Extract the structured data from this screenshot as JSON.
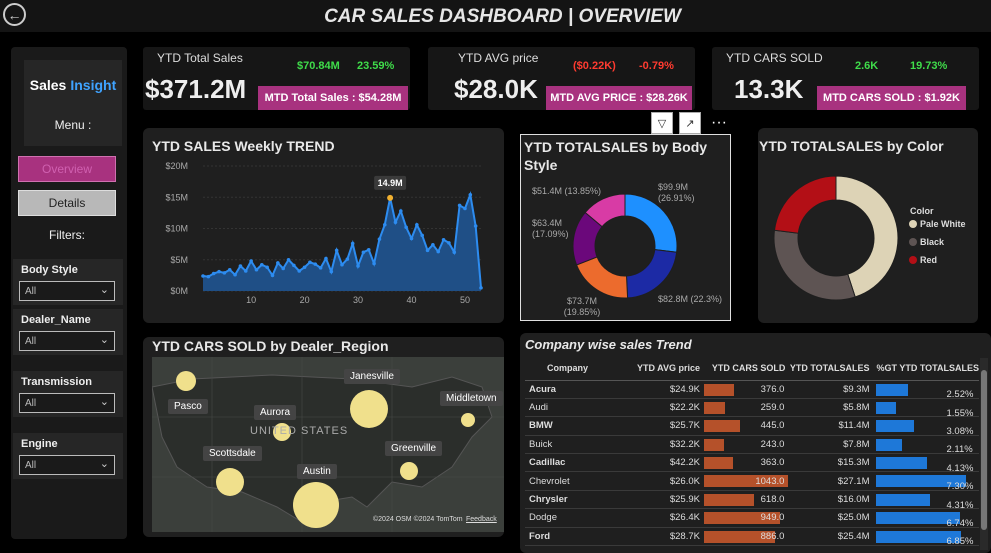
{
  "header": {
    "title": "CAR SALES DASHBOARD | OVERVIEW",
    "back_icon": "back-arrow-icon"
  },
  "sidebar": {
    "brand_part1": "Sales",
    "brand_part2": "Insight",
    "menu_label": "Menu :",
    "nav": [
      {
        "label": "Overview",
        "active": true
      },
      {
        "label": "Details",
        "active": false
      }
    ],
    "filters_label": "Filters:",
    "filters": [
      {
        "label": "Body Style",
        "value": "All"
      },
      {
        "label": "Dealer_Name",
        "value": "All"
      },
      {
        "label": "Transmission",
        "value": "All"
      },
      {
        "label": "Engine",
        "value": "All"
      }
    ]
  },
  "kpis": [
    {
      "label": "YTD Total Sales",
      "value": "$371.2M",
      "delta": "$70.84M",
      "pct": "23.59%",
      "trend": "up",
      "mtd": "MTD Total Sales : $54.28M"
    },
    {
      "label": "YTD AVG price",
      "value": "$28.0K",
      "delta": "($0.22K)",
      "pct": "-0.79%",
      "trend": "down",
      "mtd": "MTD AVG PRICE : $28.26K"
    },
    {
      "label": "YTD CARS SOLD",
      "value": "13.3K",
      "delta": "2.6K",
      "pct": "19.73%",
      "trend": "up",
      "mtd": "MTD CARS SOLD : $1.92K"
    }
  ],
  "visual_tools": {
    "filter_icon": "filter-icon",
    "focus_icon": "focus-mode-icon",
    "more_icon": "more-options-icon",
    "more_label": "···"
  },
  "weekly_trend": {
    "title": "YTD SALES Weekly TREND",
    "tooltip": "14.9M",
    "chart_data": {
      "type": "area",
      "title": "YTD SALES Weekly TREND",
      "yticks": [
        "$20M",
        "$15M",
        "$10M",
        "$5M",
        "$0M"
      ],
      "xticks": [
        "10",
        "20",
        "30",
        "40",
        "50"
      ],
      "ylim": [
        0,
        20
      ],
      "xlim": [
        1,
        53
      ],
      "highlight": {
        "x": 36,
        "y": 14.9,
        "label": "14.9M"
      },
      "x": [
        1,
        2,
        3,
        4,
        5,
        6,
        7,
        8,
        9,
        10,
        11,
        12,
        13,
        14,
        15,
        16,
        17,
        18,
        19,
        20,
        21,
        22,
        23,
        24,
        25,
        26,
        27,
        28,
        29,
        30,
        31,
        32,
        33,
        34,
        35,
        36,
        37,
        38,
        39,
        40,
        41,
        42,
        43,
        44,
        45,
        46,
        47,
        48,
        49,
        50,
        51,
        52,
        53
      ],
      "values": [
        2.4,
        2.3,
        2.8,
        3.1,
        2.9,
        3.4,
        2.6,
        4.0,
        3.2,
        4.8,
        3.4,
        4.2,
        3.8,
        2.5,
        4.5,
        3.6,
        5.0,
        4.1,
        3.2,
        3.8,
        4.6,
        4.3,
        3.7,
        5.2,
        3.1,
        6.5,
        4.2,
        5.1,
        7.6,
        4.0,
        6.2,
        6.6,
        4.4,
        8.3,
        10.6,
        14.9,
        11.0,
        12.8,
        10.2,
        8.4,
        10.6,
        8.9,
        6.5,
        7.4,
        6.3,
        8.2,
        7.7,
        6.2,
        13.7,
        13.2,
        15.4,
        10.4,
        0.5
      ]
    }
  },
  "body_style": {
    "title": "YTD TOTALSALES by Body Style",
    "chart_data": {
      "type": "pie",
      "slices": [
        {
          "label": "$99.9M\n(26.91%)",
          "value": 26.91,
          "color": "#1e90ff"
        },
        {
          "label": "$82.8M (22.3%)",
          "value": 22.3,
          "color": "#1c2aa5"
        },
        {
          "label": "$73.7M\n(19.85%)",
          "value": 19.85,
          "color": "#ec6b2d"
        },
        {
          "label": "$63.4M\n(17.09%)",
          "value": 17.09,
          "color": "#6b087b"
        },
        {
          "label": "$51.4M (13.85%)",
          "value": 13.85,
          "color": "#d83ba5"
        }
      ]
    }
  },
  "color_sales": {
    "title": "YTD TOTALSALES by Color",
    "legend_title": "Color",
    "chart_data": {
      "type": "pie",
      "slices": [
        {
          "name": "Pale White",
          "value": 45,
          "color": "#ddd3b6"
        },
        {
          "name": "Black",
          "value": 32,
          "color": "#5e5453"
        },
        {
          "name": "Red",
          "value": 23,
          "color": "#b30f16"
        }
      ]
    }
  },
  "dealer_region": {
    "title": "YTD CARS SOLD by Dealer_Region",
    "map_label": "UNITED STATES",
    "attribution": "©2024 OSM  ©2024 TomTom",
    "feedback": "Feedback",
    "regions": [
      "Pasco",
      "Aurora",
      "Janesville",
      "Middletown",
      "Scottsdale",
      "Greenville",
      "Austin"
    ]
  },
  "company_table": {
    "title": "Company wise sales Trend",
    "columns": [
      "Company",
      "YTD AVG price",
      "YTD CARS SOLD",
      "YTD TOTALSALES",
      "%GT YTD TOTALSALES"
    ],
    "rows": [
      {
        "company": "Acura",
        "avg": "$24.9K",
        "cars": "376.0",
        "cars_n": 376,
        "total": "$9.3M",
        "pct": "2.52%",
        "pct_n": 2.52,
        "bold": true
      },
      {
        "company": "Audi",
        "avg": "$22.2K",
        "cars": "259.0",
        "cars_n": 259,
        "total": "$5.8M",
        "pct": "1.55%",
        "pct_n": 1.55,
        "bold": false
      },
      {
        "company": "BMW",
        "avg": "$25.7K",
        "cars": "445.0",
        "cars_n": 445,
        "total": "$11.4M",
        "pct": "3.08%",
        "pct_n": 3.08,
        "bold": true
      },
      {
        "company": "Buick",
        "avg": "$32.2K",
        "cars": "243.0",
        "cars_n": 243,
        "total": "$7.8M",
        "pct": "2.11%",
        "pct_n": 2.11,
        "bold": false
      },
      {
        "company": "Cadillac",
        "avg": "$42.2K",
        "cars": "363.0",
        "cars_n": 363,
        "total": "$15.3M",
        "pct": "4.13%",
        "pct_n": 4.13,
        "bold": true
      },
      {
        "company": "Chevrolet",
        "avg": "$26.0K",
        "cars": "1043.0",
        "cars_n": 1043,
        "total": "$27.1M",
        "pct": "7.30%",
        "pct_n": 7.3,
        "bold": false
      },
      {
        "company": "Chrysler",
        "avg": "$25.9K",
        "cars": "618.0",
        "cars_n": 618,
        "total": "$16.0M",
        "pct": "4.31%",
        "pct_n": 4.31,
        "bold": true
      },
      {
        "company": "Dodge",
        "avg": "$26.4K",
        "cars": "949.0",
        "cars_n": 949,
        "total": "$25.0M",
        "pct": "6.74%",
        "pct_n": 6.74,
        "bold": false
      },
      {
        "company": "Ford",
        "avg": "$28.7K",
        "cars": "886.0",
        "cars_n": 886,
        "total": "$25.4M",
        "pct": "6.85%",
        "pct_n": 6.85,
        "bold": true
      }
    ]
  }
}
